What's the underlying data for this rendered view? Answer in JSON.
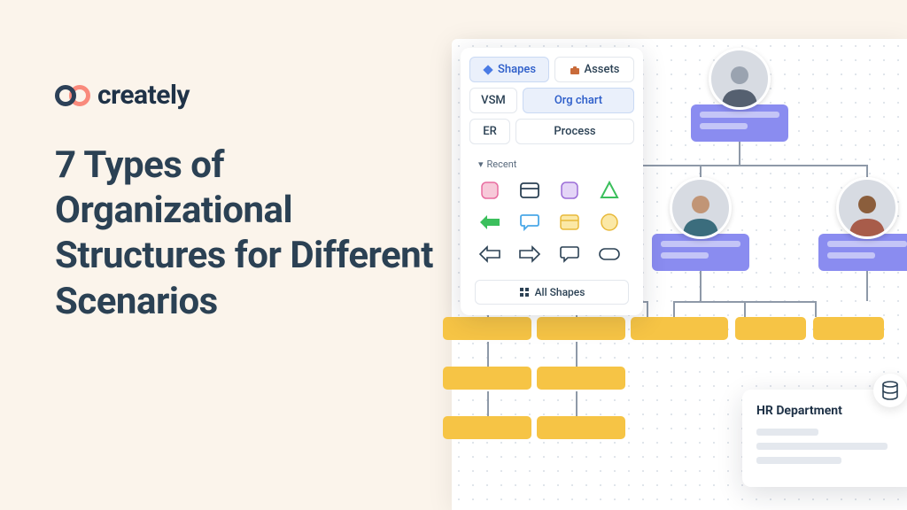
{
  "brand": {
    "name": "creately"
  },
  "headline": "7 Types of Organizational Structures for Different Scenarios",
  "shapes_panel": {
    "tabs": [
      {
        "label": "Shapes",
        "active": true,
        "icon": "diamond"
      },
      {
        "label": "Assets",
        "active": false,
        "icon": "briefcase"
      }
    ],
    "category_buttons": [
      {
        "label": "VSM",
        "active": false
      },
      {
        "label": "Org chart",
        "active": true
      },
      {
        "label": "ER",
        "active": false
      },
      {
        "label": "Process",
        "active": false
      }
    ],
    "recent_label": "Recent",
    "shapes": [
      "rounded-square-pink",
      "card-black-outline",
      "rounded-square-purple",
      "triangle-green",
      "arrow-left-green",
      "speech-bubble-blue",
      "card-yellow",
      "circle-yellow",
      "arrow-left-outline",
      "arrow-right-outline",
      "speech-bubble-outline",
      "pill-outline"
    ],
    "all_shapes_label": "All Shapes"
  },
  "detail_card": {
    "title": "HR Department",
    "icon": "database"
  },
  "colors": {
    "bg": "#FBF4EB",
    "text_dark": "#2B4154",
    "node_purple": "#8A8CF0",
    "child_yellow": "#F6C445",
    "accent_coral": "#F98A7C"
  }
}
